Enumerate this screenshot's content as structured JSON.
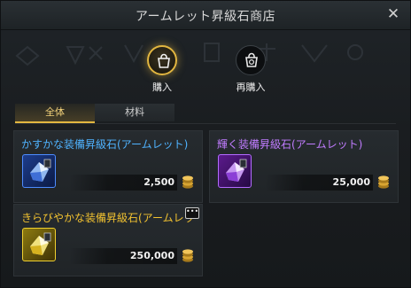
{
  "window": {
    "title": "アームレット昇級石商店",
    "close_label": "✕"
  },
  "modes": [
    {
      "label": "購入",
      "active": true,
      "icon": "shopping-bag-icon"
    },
    {
      "label": "再購入",
      "active": false,
      "icon": "rebuy-bag-icon"
    }
  ],
  "tabs": [
    {
      "label": "全体",
      "active": true
    },
    {
      "label": "材料",
      "active": false
    }
  ],
  "items": [
    {
      "name": "かすかな装備昇級石(アームレット)",
      "price": "2,500",
      "name_color": "#4fb3ff",
      "icon": "blue-upgrade-stone-icon"
    },
    {
      "name": "輝く装備昇級石(アームレット)",
      "price": "25,000",
      "name_color": "#c07cff",
      "icon": "purple-upgrade-stone-icon"
    },
    {
      "name": "きらびやかな装備昇級石(アームレッ",
      "price": "250,000",
      "name_color": "#f2c230",
      "icon": "gold-upgrade-stone-icon"
    }
  ],
  "colors": {
    "accent": "#e2b640"
  },
  "currency_icon": "gold-coin-icon"
}
